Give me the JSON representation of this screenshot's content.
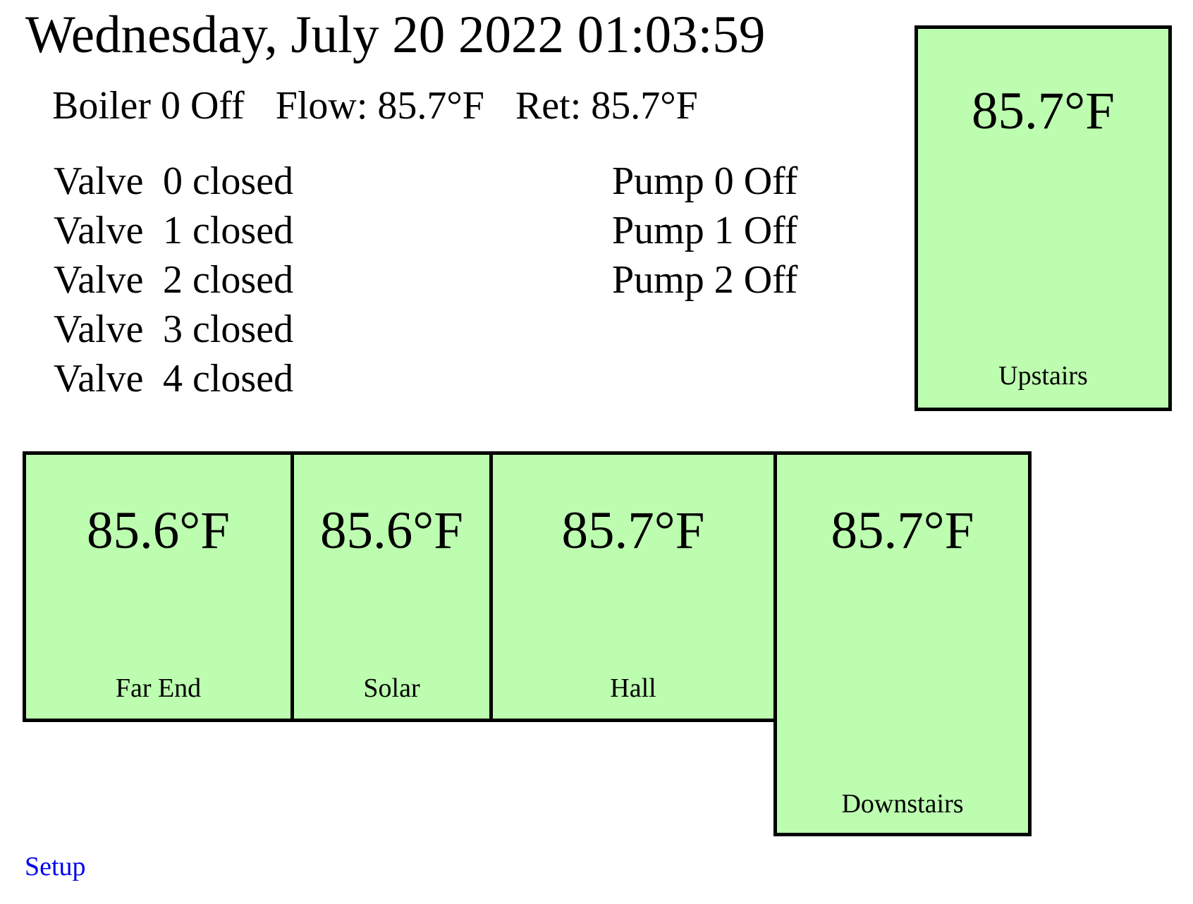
{
  "datetime": "Wednesday, July 20 2022 01:03:59",
  "boiler": {
    "status": "Boiler 0 Off",
    "flow": "Flow: 85.7°F",
    "ret": "Ret: 85.7°F"
  },
  "valves": [
    {
      "label": "Valve",
      "number": "0",
      "state": "closed"
    },
    {
      "label": "Valve",
      "number": "1",
      "state": "closed"
    },
    {
      "label": "Valve",
      "number": "2",
      "state": "closed"
    },
    {
      "label": "Valve",
      "number": "3",
      "state": "closed"
    },
    {
      "label": "Valve",
      "number": "4",
      "state": "closed"
    }
  ],
  "pumps": [
    "Pump 0 Off",
    "Pump 1 Off",
    "Pump 2 Off"
  ],
  "zones": {
    "upstairs": {
      "temp": "85.7°F",
      "name": "Upstairs"
    },
    "far_end": {
      "temp": "85.6°F",
      "name": "Far End"
    },
    "solar": {
      "temp": "85.6°F",
      "name": "Solar"
    },
    "hall": {
      "temp": "85.7°F",
      "name": "Hall"
    },
    "downstairs": {
      "temp": "85.7°F",
      "name": "Downstairs"
    }
  },
  "colors": {
    "zone_fill": "#bdfdb0",
    "zone_border": "#000000",
    "link": "#0000ee"
  },
  "setup_link": "Setup"
}
